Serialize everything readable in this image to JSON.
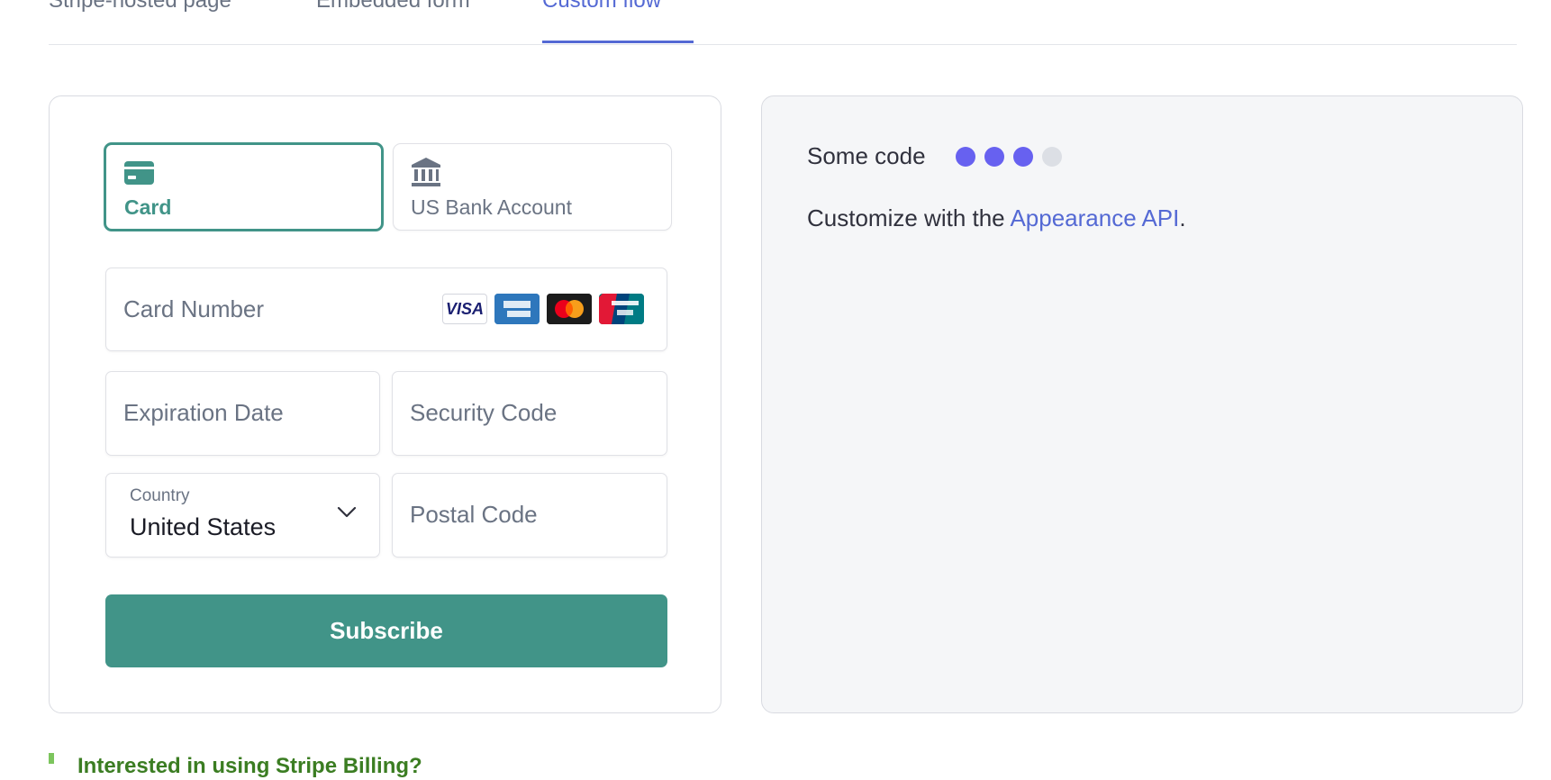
{
  "tabs": [
    {
      "label": "Stripe-hosted page"
    },
    {
      "label": "Embedded form"
    },
    {
      "label": "Custom flow"
    }
  ],
  "active_tab": "Custom flow",
  "payment_methods": [
    {
      "label": "Card",
      "icon": "credit-card-icon",
      "selected": true
    },
    {
      "label": "US Bank Account",
      "icon": "bank-icon",
      "selected": false
    }
  ],
  "fields": {
    "card_number_placeholder": "Card Number",
    "expiration_placeholder": "Expiration Date",
    "security_placeholder": "Security Code",
    "country_label": "Country",
    "country_value": "United States",
    "postal_placeholder": "Postal Code"
  },
  "card_brands": {
    "visa": "VISA",
    "amex": "amex-logo",
    "mastercard": "mastercard-logo",
    "unionpay": "unionpay-logo"
  },
  "subscribe_label": "Subscribe",
  "code_panel": {
    "title": "Some code",
    "desc_prefix": "Customize with the ",
    "desc_link": "Appearance API",
    "desc_suffix": ".",
    "progress_dots": [
      {
        "color": "#6761f0",
        "filled": true
      },
      {
        "color": "#6761f0",
        "filled": true
      },
      {
        "color": "#6761f0",
        "filled": true
      },
      {
        "color": "#dcdfe5",
        "filled": false
      }
    ]
  },
  "callout": {
    "text": "Interested in using Stripe Billing?"
  },
  "colors": {
    "accent": "#5469d4",
    "primary": "#419488",
    "callout_bar": "#7cc55d",
    "callout_text": "#3b7d22"
  }
}
